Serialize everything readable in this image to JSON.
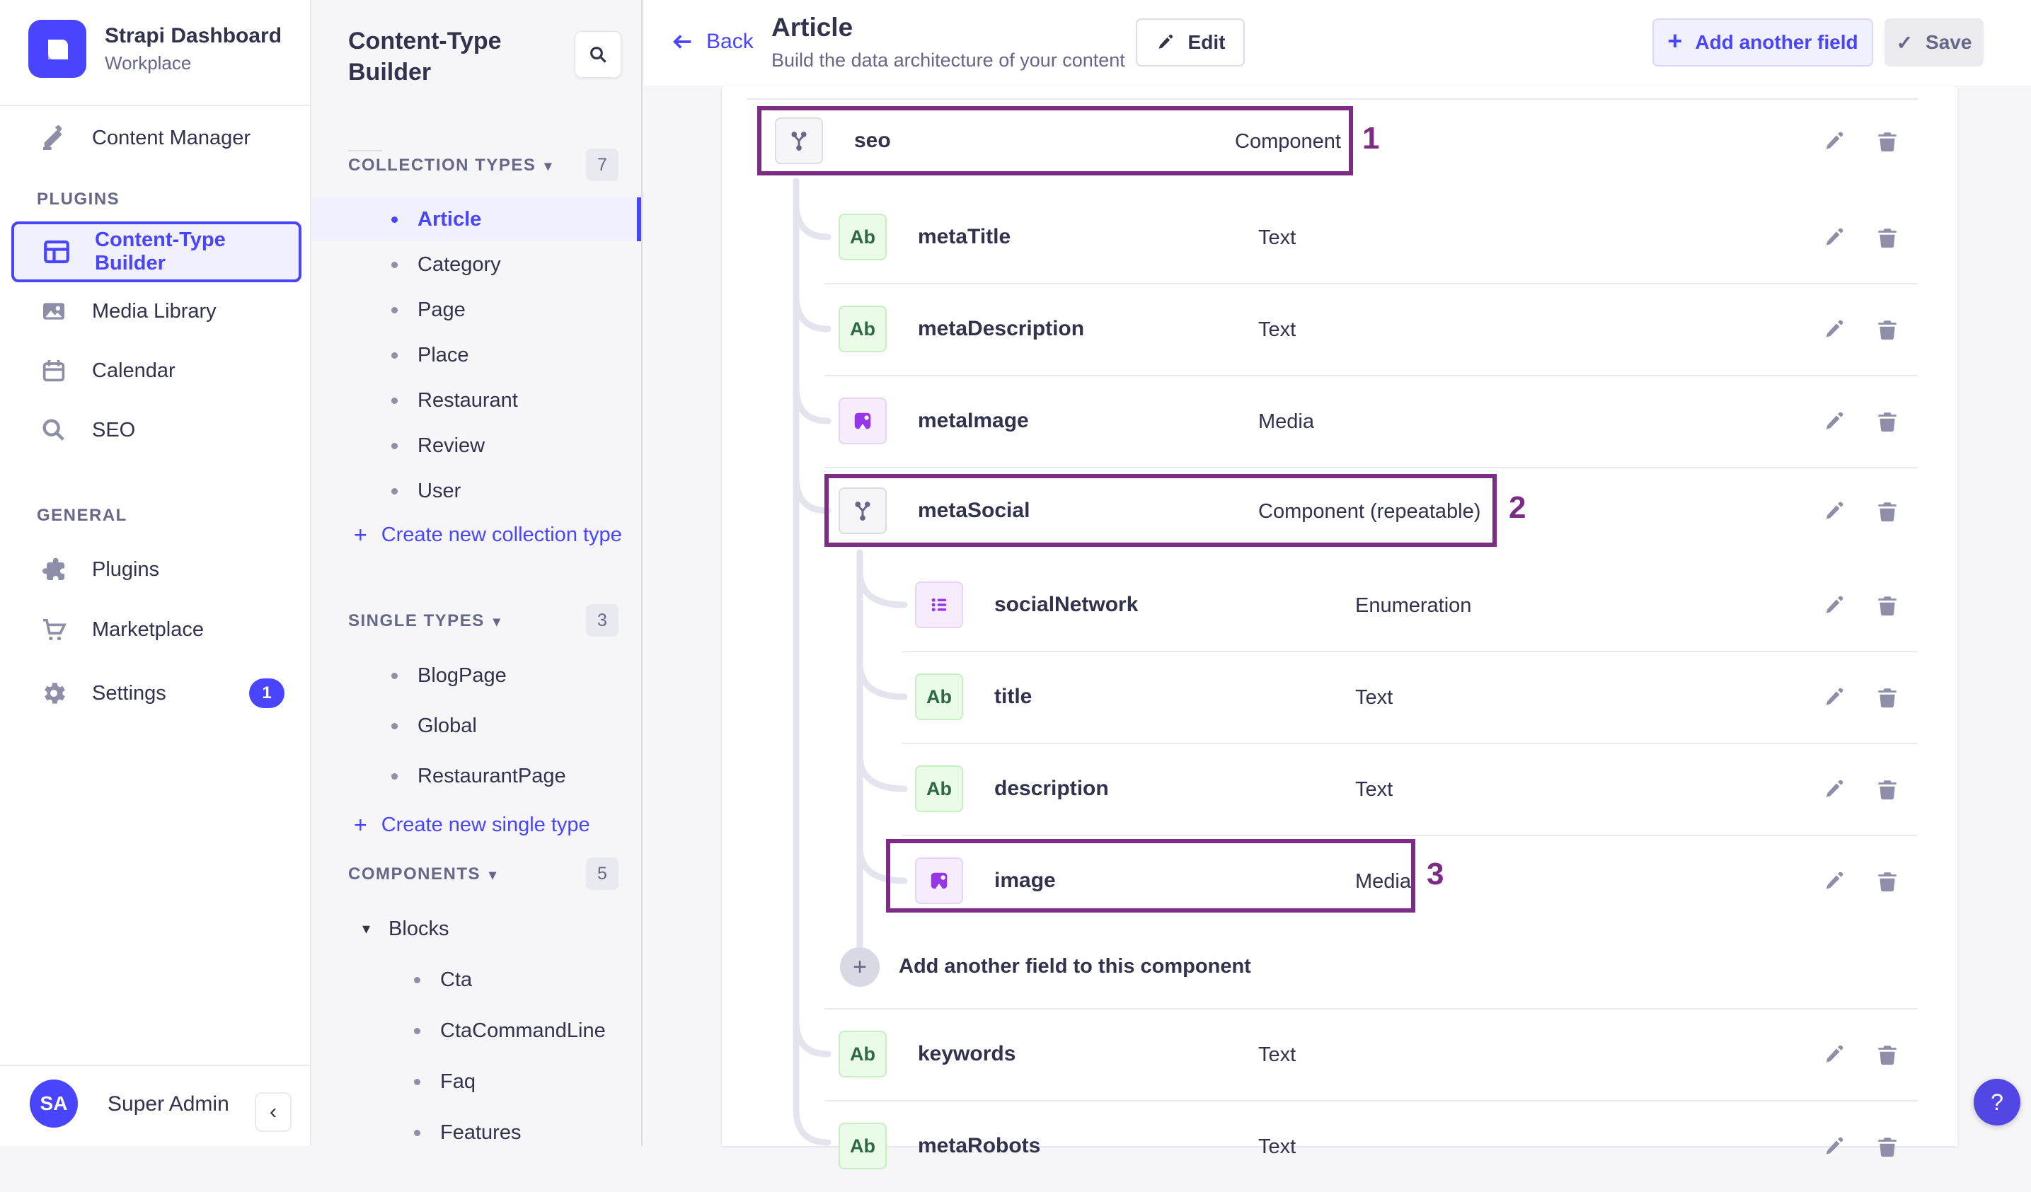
{
  "app": {
    "name": "Strapi Dashboard",
    "workspace": "Workplace",
    "user_initials": "SA",
    "user_name": "Super Admin",
    "collapse_glyph": "‹",
    "help_glyph": "?"
  },
  "colors": {
    "accent": "#4945ff",
    "annotation": "#7d2c85",
    "success_icon": "#2f6846",
    "alt_icon": "#9736e8"
  },
  "nav": {
    "content_manager": "Content Manager",
    "sections": [
      {
        "title": "PLUGINS",
        "items": [
          {
            "label": "Content-Type Builder"
          },
          {
            "label": "Media Library"
          },
          {
            "label": "Calendar"
          },
          {
            "label": "SEO"
          }
        ]
      },
      {
        "title": "GENERAL",
        "items": [
          {
            "label": "Plugins"
          },
          {
            "label": "Marketplace"
          },
          {
            "label": "Settings",
            "badge": "1"
          }
        ]
      }
    ]
  },
  "subnav": {
    "title": "Content-Type Builder",
    "collection_types": {
      "title": "COLLECTION TYPES",
      "count": "7",
      "caret": "▾",
      "items": [
        "Article",
        "Category",
        "Page",
        "Place",
        "Restaurant",
        "Review",
        "User"
      ],
      "action": "Create new collection type"
    },
    "single_types": {
      "title": "SINGLE TYPES",
      "count": "3",
      "caret": "▾",
      "items": [
        "BlogPage",
        "Global",
        "RestaurantPage"
      ],
      "action": "Create new single type"
    },
    "components": {
      "title": "COMPONENTS",
      "count": "5",
      "caret": "▾",
      "groups": [
        {
          "label": "Blocks",
          "caret": "▾",
          "items": [
            "Cta",
            "CtaCommandLine",
            "Faq",
            "Features"
          ]
        }
      ]
    }
  },
  "header": {
    "back": "Back",
    "title": "Article",
    "subtitle": "Build the data architecture of your content",
    "edit": "Edit",
    "add_field": "Add another field",
    "add_plus": "+",
    "save": "Save",
    "save_check": "✓"
  },
  "table": {
    "text_icon_glyph": "Ab",
    "add_plus": "+",
    "fields": [
      {
        "name": "seo",
        "type": "Component",
        "icon": "component",
        "annotation": "1"
      },
      {
        "name": "metaTitle",
        "type": "Text",
        "icon": "text"
      },
      {
        "name": "metaDescription",
        "type": "Text",
        "icon": "text"
      },
      {
        "name": "metaImage",
        "type": "Media",
        "icon": "media"
      },
      {
        "name": "metaSocial",
        "type": "Component (repeatable)",
        "icon": "component",
        "annotation": "2"
      },
      {
        "name": "socialNetwork",
        "type": "Enumeration",
        "icon": "enumeration"
      },
      {
        "name": "title",
        "type": "Text",
        "icon": "text"
      },
      {
        "name": "description",
        "type": "Text",
        "icon": "text"
      },
      {
        "name": "image",
        "type": "Media",
        "icon": "media",
        "annotation": "3"
      },
      {
        "name": "Add another field to this component",
        "icon": "add"
      },
      {
        "name": "keywords",
        "type": "Text",
        "icon": "text"
      },
      {
        "name": "metaRobots",
        "type": "Text",
        "icon": "text"
      }
    ]
  }
}
